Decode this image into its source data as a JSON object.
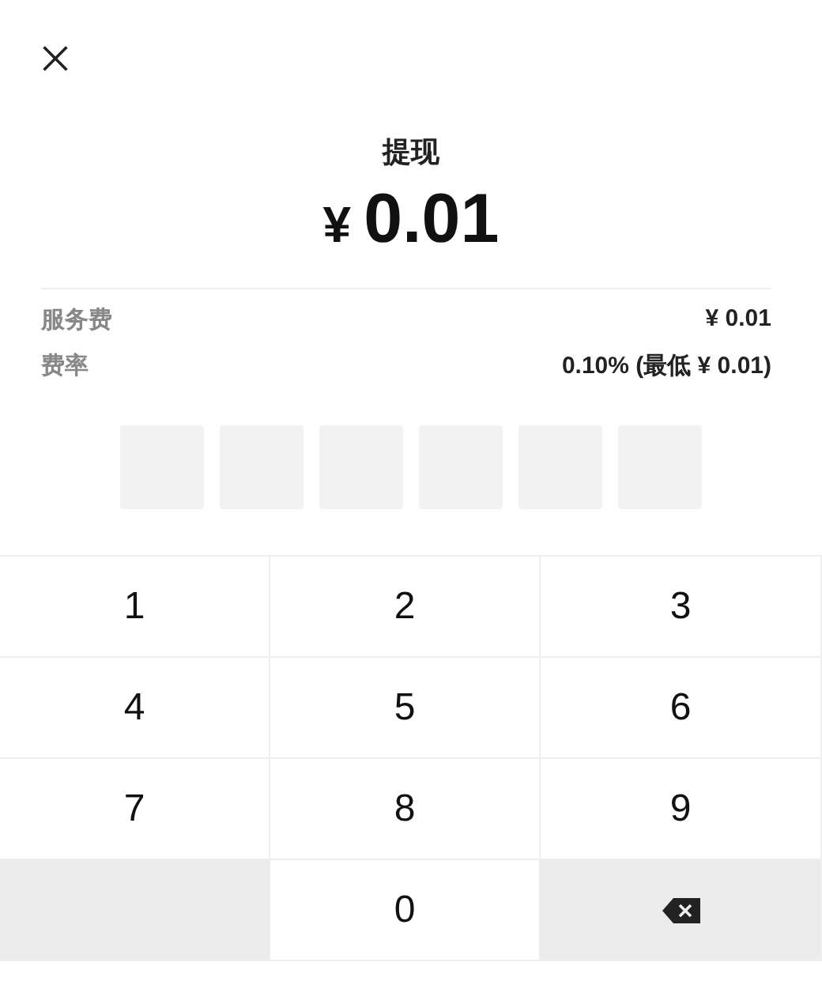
{
  "title": "提现",
  "amount": {
    "currency": "¥",
    "value": "0.01"
  },
  "fees": [
    {
      "label": "服务费",
      "value": "¥ 0.01"
    },
    {
      "label": "费率",
      "value": "0.10% (最低 ¥ 0.01)"
    }
  ],
  "pin_slots": [
    {
      "filled": false
    },
    {
      "filled": false
    },
    {
      "filled": false
    },
    {
      "filled": false
    },
    {
      "filled": false
    },
    {
      "filled": false
    }
  ],
  "keypad": [
    {
      "kind": "digit",
      "label": "1"
    },
    {
      "kind": "digit",
      "label": "2"
    },
    {
      "kind": "digit",
      "label": "3"
    },
    {
      "kind": "digit",
      "label": "4"
    },
    {
      "kind": "digit",
      "label": "5"
    },
    {
      "kind": "digit",
      "label": "6"
    },
    {
      "kind": "digit",
      "label": "7"
    },
    {
      "kind": "digit",
      "label": "8"
    },
    {
      "kind": "digit",
      "label": "9"
    },
    {
      "kind": "blank"
    },
    {
      "kind": "digit",
      "label": "0"
    },
    {
      "kind": "backspace"
    }
  ]
}
